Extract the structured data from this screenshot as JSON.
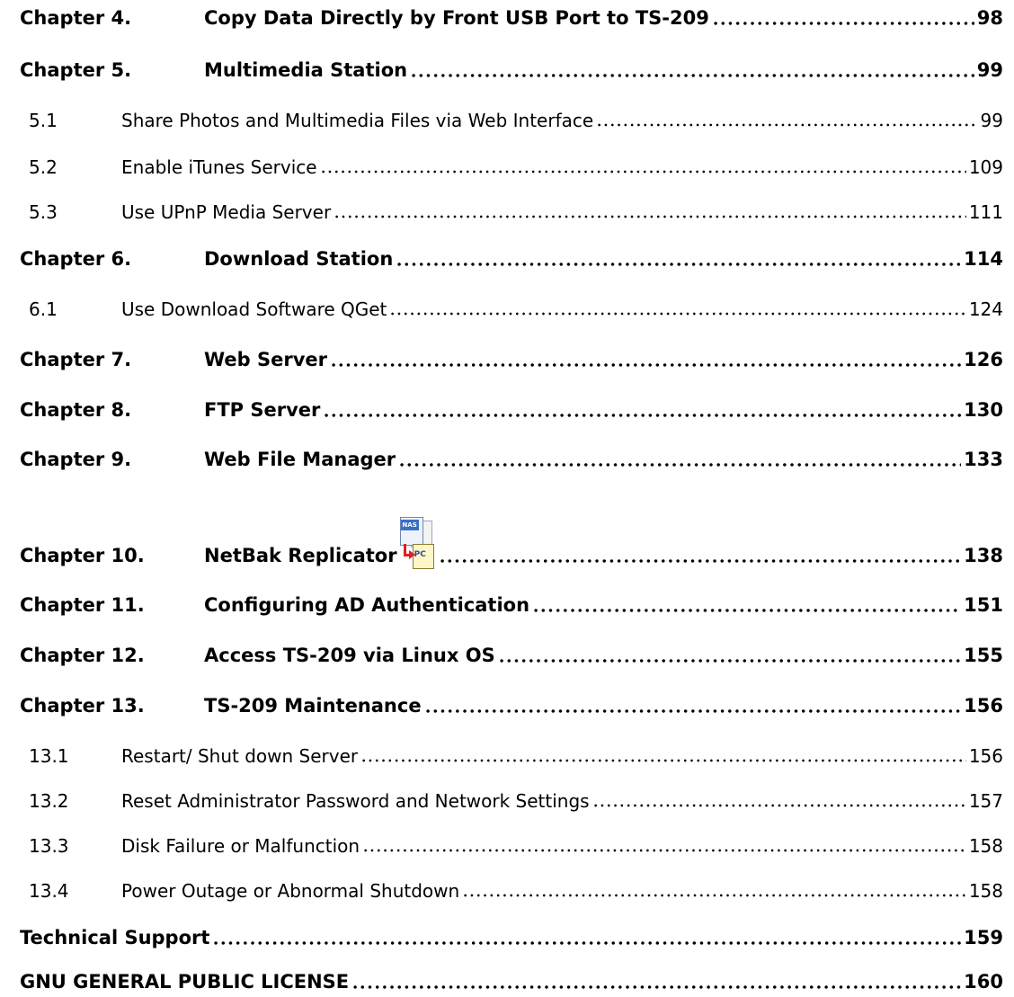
{
  "toc": {
    "entries": [
      {
        "type": "chapter",
        "label": "Chapter 4.",
        "title": "Copy Data Directly by Front USB Port to TS-209",
        "page": "98"
      },
      {
        "type": "chapter",
        "label": "Chapter 5.",
        "title": "Multimedia Station",
        "page": "99"
      },
      {
        "type": "section",
        "label": "5.1",
        "title": "Share Photos and Multimedia Files via Web Interface",
        "page": "99"
      },
      {
        "type": "section",
        "label": "5.2",
        "title": "Enable iTunes Service",
        "page": "109"
      },
      {
        "type": "section",
        "label": "5.3",
        "title": "Use UPnP Media Server",
        "page": "111"
      },
      {
        "type": "chapter",
        "label": "Chapter 6.",
        "title": "Download Station",
        "page": "114"
      },
      {
        "type": "section",
        "label": "6.1",
        "title": "Use Download Software QGet",
        "page": "124"
      },
      {
        "type": "chapter",
        "label": "Chapter 7.",
        "title": "Web Server",
        "page": "126"
      },
      {
        "type": "chapter",
        "label": "Chapter 8.",
        "title": "FTP Server",
        "page": "130"
      },
      {
        "type": "chapter",
        "label": "Chapter 9.",
        "title": "Web File Manager",
        "page": "133"
      },
      {
        "type": "chapter",
        "label": "Chapter 10.",
        "title": "NetBak Replicator",
        "page": "138",
        "icon": "netbak-replicator-icon"
      },
      {
        "type": "chapter",
        "label": "Chapter 11.",
        "title": "Configuring AD Authentication",
        "page": "151"
      },
      {
        "type": "chapter",
        "label": "Chapter 12.",
        "title": "Access TS-209 via Linux OS",
        "page": "155"
      },
      {
        "type": "chapter",
        "label": "Chapter 13.",
        "title": "TS-209 Maintenance",
        "page": "156"
      },
      {
        "type": "section",
        "label": "13.1",
        "title": "Restart/ Shut down Server",
        "page": "156"
      },
      {
        "type": "section",
        "label": "13.2",
        "title": "Reset Administrator Password and Network Settings",
        "page": "157"
      },
      {
        "type": "section",
        "label": "13.3",
        "title": "Disk Failure or Malfunction",
        "page": "158"
      },
      {
        "type": "section",
        "label": "13.4",
        "title": "Power Outage or Abnormal Shutdown",
        "page": "158"
      },
      {
        "type": "chapter",
        "label": "",
        "title": "Technical Support",
        "page": "159"
      },
      {
        "type": "chapter",
        "label": "",
        "title": "GNU GENERAL PUBLIC LICENSE",
        "page": "160"
      }
    ]
  },
  "icons": {
    "netbak": {
      "top_label": "NAS",
      "bottom_label": "PC",
      "arrow_color": "#e02020"
    }
  }
}
